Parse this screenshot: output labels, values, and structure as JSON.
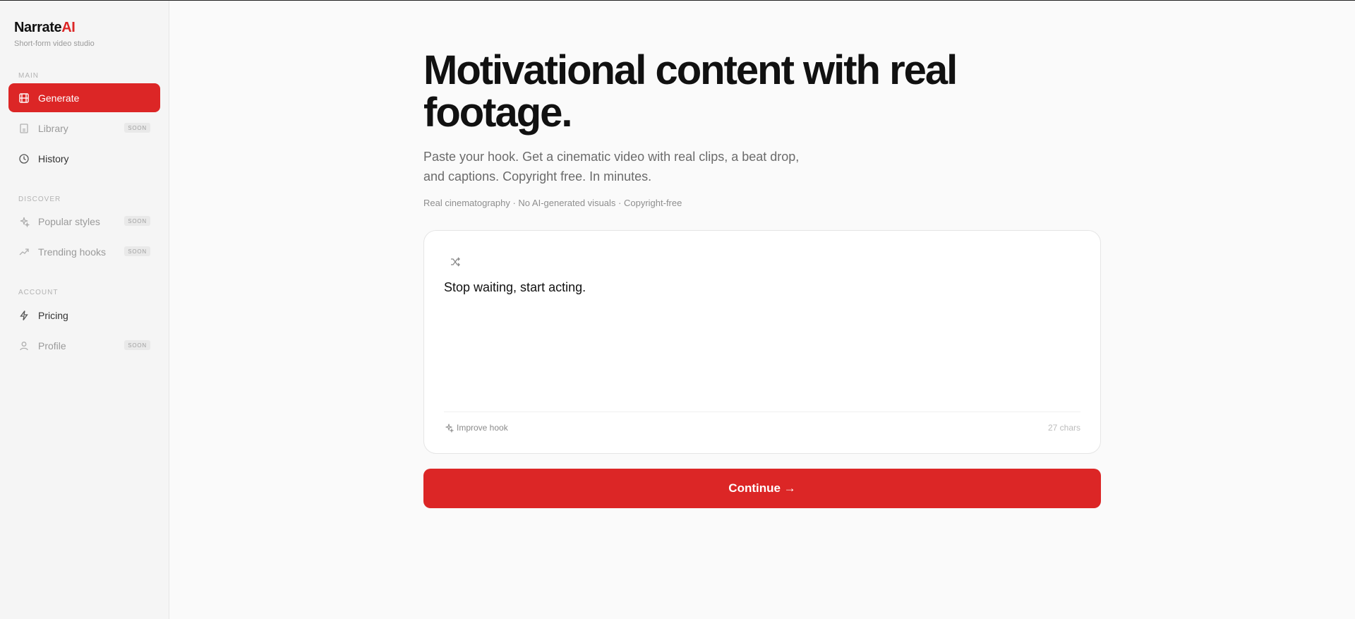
{
  "brand": {
    "name": "Narrate",
    "accent": "AI",
    "tagline": "Short-form video studio",
    "accent_color": "#dc2626"
  },
  "sidebar": {
    "sections": [
      {
        "label": "MAIN",
        "items": [
          {
            "label": "Generate",
            "icon": "film-icon",
            "state": "active"
          },
          {
            "label": "Library",
            "icon": "library-icon",
            "state": "soon",
            "badge": "SOON"
          },
          {
            "label": "History",
            "icon": "clock-icon",
            "state": "normal"
          }
        ]
      },
      {
        "label": "DISCOVER",
        "items": [
          {
            "label": "Popular styles",
            "icon": "sparkles-icon",
            "state": "soon",
            "badge": "SOON"
          },
          {
            "label": "Trending hooks",
            "icon": "trending-up-icon",
            "state": "soon",
            "badge": "SOON"
          }
        ]
      },
      {
        "label": "ACCOUNT",
        "items": [
          {
            "label": "Pricing",
            "icon": "lightning-icon",
            "state": "normal"
          },
          {
            "label": "Profile",
            "icon": "user-icon",
            "state": "soon",
            "badge": "SOON"
          }
        ]
      }
    ]
  },
  "main": {
    "headline": "Motivational content with real footage.",
    "subtitle": "Paste your hook. Get a cinematic video with real clips, a beat drop, and captions. Copyright free. In minutes.",
    "tagline": "Real cinematography · No AI-generated visuals · Copyright-free",
    "hook": {
      "value": "Stop waiting, start acting.",
      "improve_label": "Improve hook",
      "char_count": "27 chars",
      "shuffle_icon": "shuffle-icon"
    },
    "continue_label": "Continue →"
  }
}
